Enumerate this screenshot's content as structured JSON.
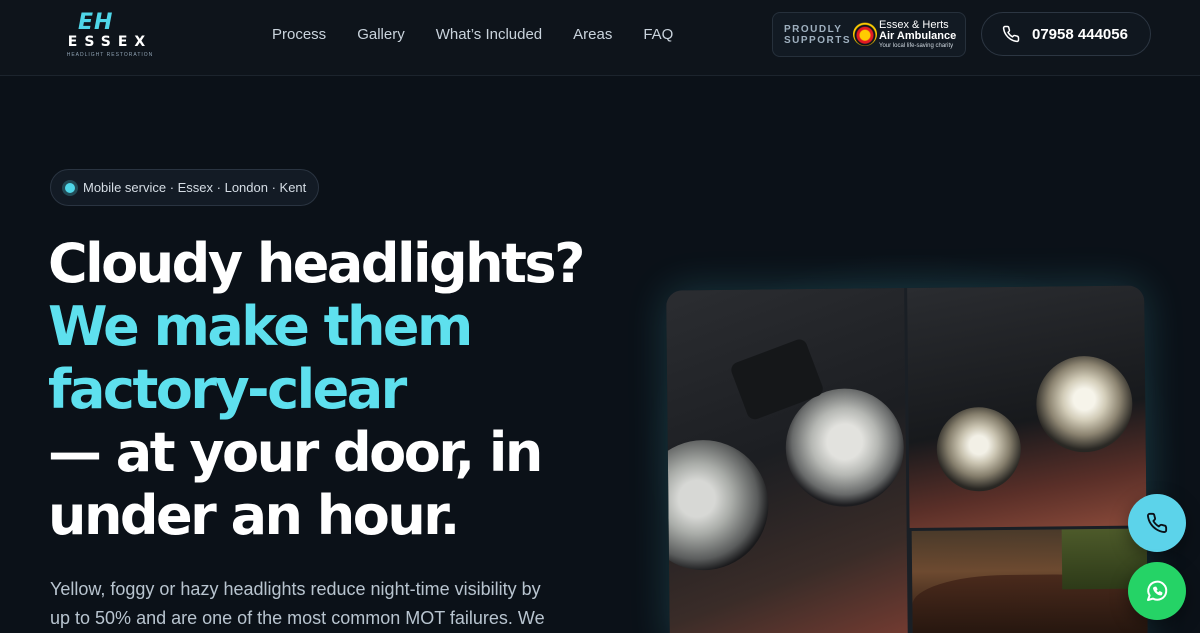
{
  "brand": {
    "mark": "EH",
    "name": "ESSEX",
    "subtitle": "HEADLIGHT RESTORATION"
  },
  "nav": {
    "items": [
      "Process",
      "Gallery",
      "What’s Included",
      "Areas",
      "FAQ"
    ]
  },
  "support": {
    "label_line1": "PROUDLY",
    "label_line2": "SUPPORTS",
    "charity_line1": "Essex & Herts",
    "charity_line2": "Air Ambulance",
    "charity_tagline": "Your local life-saving charity"
  },
  "header_phone": {
    "number": "07958 444056",
    "icon": "phone-icon"
  },
  "hero": {
    "pill_text": "Mobile service · Essex · London · Kent",
    "headline_line1": "Cloudy headlights?",
    "headline_accent1": "We make them",
    "headline_accent2": "factory-clear",
    "headline_line3": "— at your door, in",
    "headline_line4": "under an hour.",
    "lead_line1": "Yellow, foggy or hazy headlights reduce night-time visibility by",
    "lead_line2": "up to 50% and are one of the most common MOT failures. We"
  },
  "colors": {
    "background": "#0b1118",
    "accent": "#5ee0ee",
    "call_button": "#5cd3ea",
    "whatsapp_button": "#25d366"
  },
  "floating_buttons": {
    "call_icon": "phone-icon",
    "whatsapp_icon": "whatsapp-icon"
  }
}
